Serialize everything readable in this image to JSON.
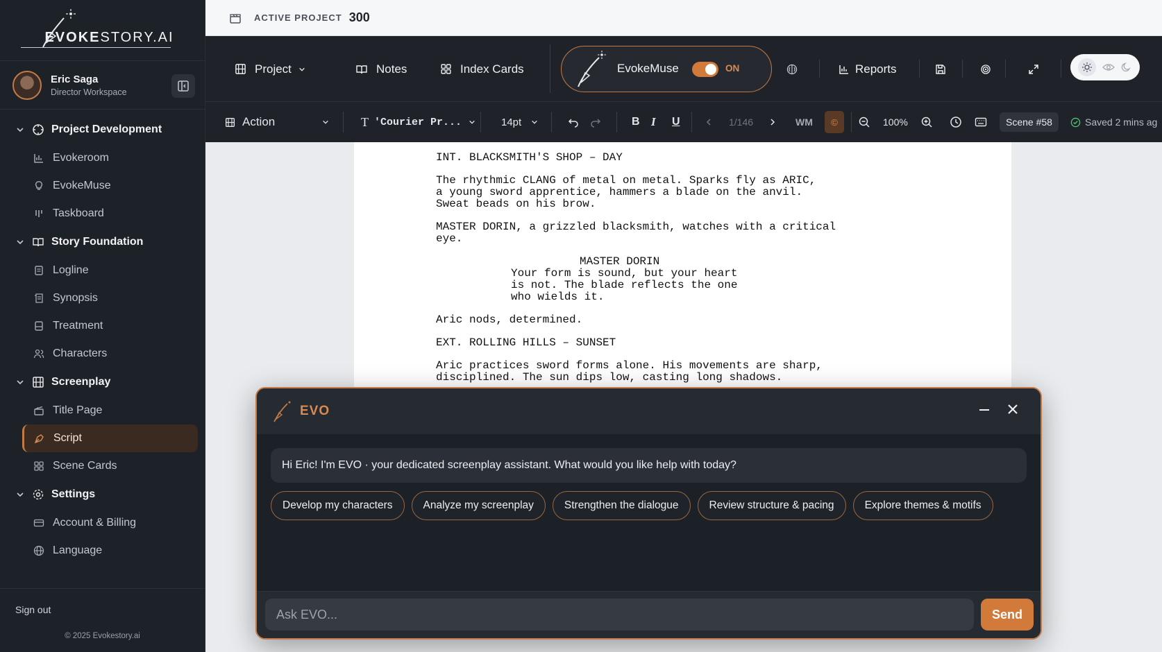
{
  "brand": {
    "logo_bold": "EVOKE",
    "logo_light": "STORY.AI"
  },
  "user": {
    "name": "Eric Saga",
    "workspace": "Director Workspace"
  },
  "nav": {
    "groups": [
      {
        "label": "Project Development",
        "items": [
          "Evokeroom",
          "EvokeMuse",
          "Taskboard"
        ]
      },
      {
        "label": "Story Foundation",
        "items": [
          "Logline",
          "Synopsis",
          "Treatment",
          "Characters"
        ]
      },
      {
        "label": "Screenplay",
        "items": [
          "Title Page",
          "Script",
          "Scene Cards"
        ]
      },
      {
        "label": "Settings",
        "items": [
          "Account & Billing",
          "Language"
        ]
      }
    ],
    "active": "Script"
  },
  "footer": {
    "signout": "Sign out",
    "copyright": "© 2025 Evokestory.ai"
  },
  "topbar": {
    "label": "ACTIVE PROJECT",
    "value": "300"
  },
  "toolbar": {
    "project": "Project",
    "notes": "Notes",
    "index_cards": "Index Cards",
    "muse_label": "EvokeMuse",
    "muse_state": "ON",
    "reports": "Reports"
  },
  "format": {
    "element": "Action",
    "font": "'Courier Pr...",
    "size": "14pt",
    "page": "1/146",
    "wm": "WM",
    "zoom": "100%",
    "scene": "Scene #58",
    "saved": "Saved 2 mins ag"
  },
  "script": {
    "lines": [
      "INT. BLACKSMITH'S SHOP – DAY",
      "",
      "The rhythmic CLANG of metal on metal. Sparks fly as ARIC,",
      "a young sword apprentice, hammers a blade on the anvil.",
      "Sweat beads on his brow.",
      "",
      "MASTER DORIN, a grizzled blacksmith, watches with a critical",
      "eye.",
      ""
    ],
    "character": "MASTER DORIN",
    "dialogue": [
      "Your form is sound, but your heart",
      "is not. The blade reflects the one",
      "who wields it."
    ],
    "after": [
      "Aric nods, determined.",
      "",
      "EXT. ROLLING HILLS – SUNSET",
      "",
      "Aric practices sword forms alone. His movements are sharp,",
      "disciplined. The sun dips low, casting long shadows."
    ]
  },
  "evo": {
    "title": "EVO",
    "greeting": "Hi Eric! I'm EVO · your dedicated screenplay assistant. What would you like help with today?",
    "chips": [
      "Develop my characters",
      "Analyze my screenplay",
      "Strengthen the dialogue",
      "Review structure & pacing",
      "Explore themes & motifs"
    ],
    "placeholder": "Ask EVO...",
    "send": "Send"
  }
}
